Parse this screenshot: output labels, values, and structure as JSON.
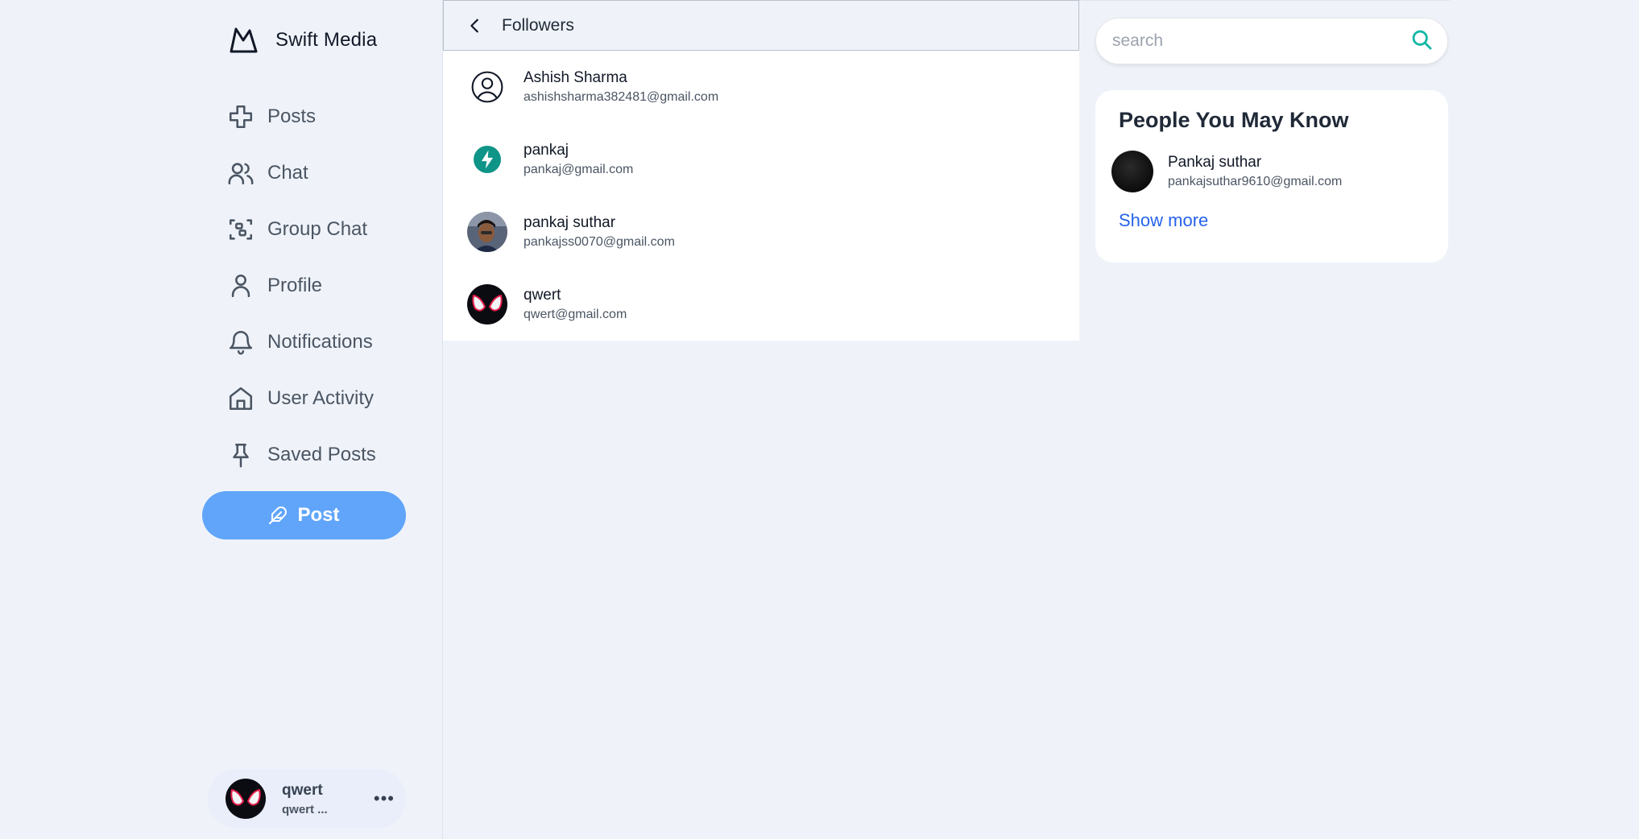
{
  "brand": {
    "name": "Swift Media",
    "icon": "mountain-logo-icon"
  },
  "sidebar": {
    "items": [
      {
        "label": "Posts",
        "icon": "plus-cross-icon"
      },
      {
        "label": "Chat",
        "icon": "users-icon"
      },
      {
        "label": "Group Chat",
        "icon": "group-scan-icon"
      },
      {
        "label": "Profile",
        "icon": "user-icon"
      },
      {
        "label": "Notifications",
        "icon": "bell-icon"
      },
      {
        "label": "User Activity",
        "icon": "home-icon"
      },
      {
        "label": "Saved Posts",
        "icon": "pin-icon"
      }
    ],
    "post_button": "Post",
    "user": {
      "name": "qwert",
      "handle": "qwert ...",
      "more": "•••"
    }
  },
  "main": {
    "title": "Followers",
    "followers": [
      {
        "name": "Ashish Sharma",
        "email": "ashishsharma382481@gmail.com",
        "avatar": "default-user-icon"
      },
      {
        "name": "pankaj",
        "email": "pankaj@gmail.com",
        "avatar": "bolt-icon"
      },
      {
        "name": "pankaj suthar",
        "email": "pankajss0070@gmail.com",
        "avatar": "photo-avatar"
      },
      {
        "name": "qwert",
        "email": "qwert@gmail.com",
        "avatar": "mask-avatar"
      }
    ]
  },
  "search": {
    "placeholder": "search"
  },
  "pymk": {
    "title": "People You May Know",
    "people": [
      {
        "name": "Pankaj suthar",
        "email": "pankajsuthar9610@gmail.com"
      }
    ],
    "show_more": "Show more"
  },
  "colors": {
    "background": "#eff3f9",
    "post_button": "#60a5fa",
    "link": "#2563eb",
    "search_icon": "#14b8a6",
    "bolt_avatar": "#0f9488"
  }
}
